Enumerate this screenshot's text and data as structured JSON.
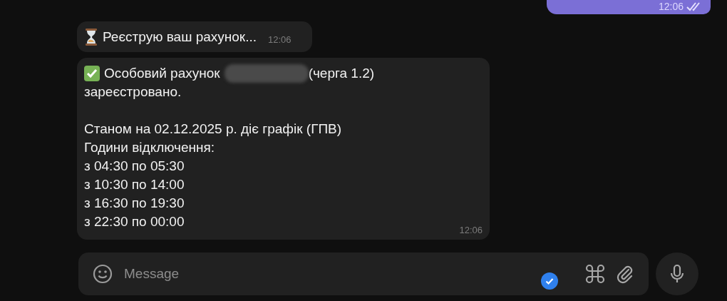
{
  "outgoing": {
    "time": "12:06",
    "read": true
  },
  "messages": [
    {
      "kind": "pending",
      "lines": [
        {
          "kind": "text",
          "parts": [
            {
              "kind": "text",
              "text": "Реєструю ваш рахунок..."
            }
          ]
        }
      ],
      "time": "12:06"
    },
    {
      "kind": "success",
      "lines": [
        {
          "kind": "text",
          "parts": [
            {
              "kind": "text",
              "text": "Особовий рахунок"
            },
            {
              "kind": "redacted"
            },
            {
              "kind": "text",
              "text": "(черга 1.2)"
            }
          ]
        },
        {
          "kind": "text",
          "parts": [
            {
              "kind": "text",
              "text": "зареєстровано."
            }
          ]
        },
        {
          "kind": "gap"
        },
        {
          "kind": "text",
          "parts": [
            {
              "kind": "text",
              "text": "Станом на 02.12.2025 р. діє графік (ГПВ)"
            }
          ]
        },
        {
          "kind": "text",
          "parts": [
            {
              "kind": "text",
              "text": "Години відключення:"
            }
          ]
        },
        {
          "kind": "text",
          "parts": [
            {
              "kind": "text",
              "text": "з 04:30 по 05:30"
            }
          ]
        },
        {
          "kind": "text",
          "parts": [
            {
              "kind": "text",
              "text": "з 10:30 по 14:00"
            }
          ]
        },
        {
          "kind": "text",
          "parts": [
            {
              "kind": "text",
              "text": "з 16:30 по 19:30"
            }
          ]
        },
        {
          "kind": "text",
          "parts": [
            {
              "kind": "text",
              "text": "з 22:30 по 00:00"
            }
          ]
        }
      ],
      "time": "12:06"
    }
  ],
  "composer": {
    "placeholder": "Message",
    "draft_checked": true
  }
}
